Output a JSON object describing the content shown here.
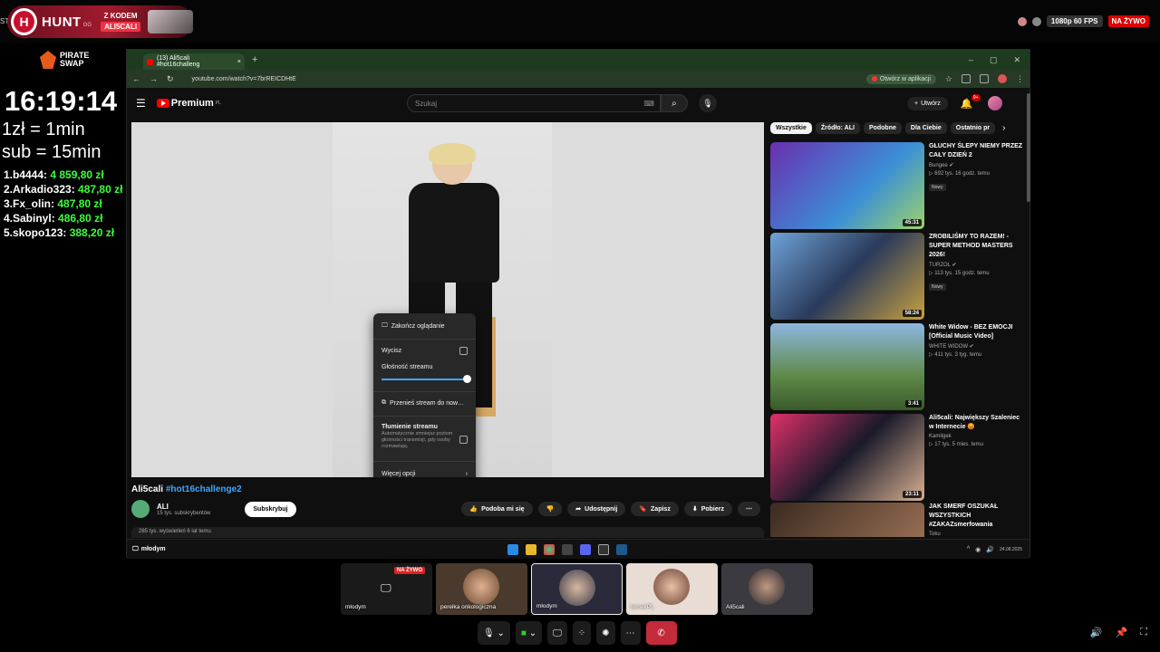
{
  "overlay": {
    "sti_label": "STI",
    "hunt_text": "HUNT",
    "hunt_sub": "GG",
    "hunt_icon": "H",
    "hunt_code_line1": "Z KODEM",
    "hunt_code_line2": "ALI5CALI",
    "pirate_line1": "PIRATE",
    "pirate_line2": "SWAP",
    "clock": "16:19:14",
    "rule1": "1zł = 1min",
    "rule2": "sub = 15min",
    "top_donors": [
      {
        "label": "1.b4444: ",
        "amount": "4 859,80 zł"
      },
      {
        "label": "2.Arkadio323: ",
        "amount": "487,80 zł"
      },
      {
        "label": "3.Fx_olin: ",
        "amount": "487,80 zł"
      },
      {
        "label": "4.Sabinyl: ",
        "amount": "486,80 zł"
      },
      {
        "label": "5.skopo123: ",
        "amount": "388,20 zł"
      }
    ],
    "quality": "1080p 60 FPS",
    "live": "NA ŻYWO"
  },
  "browser": {
    "tab_title": "(13) Ali5cali #hot16challeng",
    "tab_close": "×",
    "new_tab": "+",
    "url": "youtube.com/watch?v=7brREICDHtE",
    "open_app": "Otwórz w aplikacji",
    "winctl": [
      "–",
      "▢",
      "✕"
    ]
  },
  "youtube": {
    "logo": "Premium",
    "logo_sup": "PL",
    "search_placeholder": "Szukaj",
    "create": "Utwórz",
    "bell_badge": "9+",
    "video_title_main": "Ali5cali ",
    "video_title_tag": "#hot16challenge2",
    "channel_name": "ALI",
    "channel_subs": "15 tys. subskrybentów",
    "subscribe": "Subskrybuj",
    "actions": [
      "Podoba mi się",
      "",
      "Udostępnij",
      "Zapisz",
      "Pobierz",
      "⋯"
    ],
    "views": "285 tys. wyświetleń  6 lat temu",
    "chips": [
      "Wszystkie",
      "Źródło: ALI",
      "Podobne",
      "Dla Ciebie",
      "Ostatnio pr"
    ],
    "recommendations": [
      {
        "title": "GŁUCHY ŚLEPY NIEMY PRZEZ CAŁY DZIEŃ 2",
        "channel": "Bungee ✔",
        "meta": "▷ 692 tys.   16 godz. temu",
        "badge": "Nowy",
        "duration": "45:31"
      },
      {
        "title": "ZROBILIŚMY TO RAZEM! - SUPER METHOD MASTERS 2026!",
        "channel": "TURZOL ✔",
        "meta": "▷ 113 tys.   15 godz. temu",
        "badge": "Nowy",
        "duration": "58:24"
      },
      {
        "title": "White Widow - BEZ EMOCJI [Official Music Video]",
        "channel": "WHITE WIDOW ✔",
        "meta": "▷ 411 tys.   3 tyg. temu",
        "badge": "",
        "duration": "3:41"
      },
      {
        "title": "Ali5cali: Największy Szaleniec w Internecie 😡",
        "channel": "Kamilgek",
        "meta": "▷ 17 tys.   5 mies. temu",
        "badge": "",
        "duration": "23:11"
      },
      {
        "title": "JAK SMERF OSZUKAŁ WSZYSTKICH #ZAKAZsmerfowania",
        "channel": "Toku",
        "meta": "",
        "badge": "",
        "duration": ""
      }
    ]
  },
  "context_menu": {
    "end_watching": "Zakończ oglądanie",
    "mute": "Wycisz",
    "stream_volume": "Głośność streamu",
    "stream_volume_level": 0.95,
    "move_stream": "Przenieś stream do now…",
    "dimming": "Tłumienie streamu",
    "dimming_desc": "Automatycznie zmniejsz poziom głośności transmisji, gdy osoby rozmawiają.",
    "more_options": "Więcej opcji"
  },
  "taskbar": {
    "user": "młodym",
    "time": "",
    "date": "24.08.2025"
  },
  "call": {
    "tiles": [
      {
        "name": "młodym",
        "live": "NA ŻYWO"
      },
      {
        "name": "perełka onkologiczna"
      },
      {
        "name": "młodym"
      },
      {
        "name": "tomekPL"
      },
      {
        "name": "Ali5cali"
      }
    ]
  },
  "colors": {
    "donor_amount": "#3bff3b",
    "yt_red": "#ff0000",
    "live_red": "#dd0000",
    "link_blue": "#3ea6ff"
  }
}
